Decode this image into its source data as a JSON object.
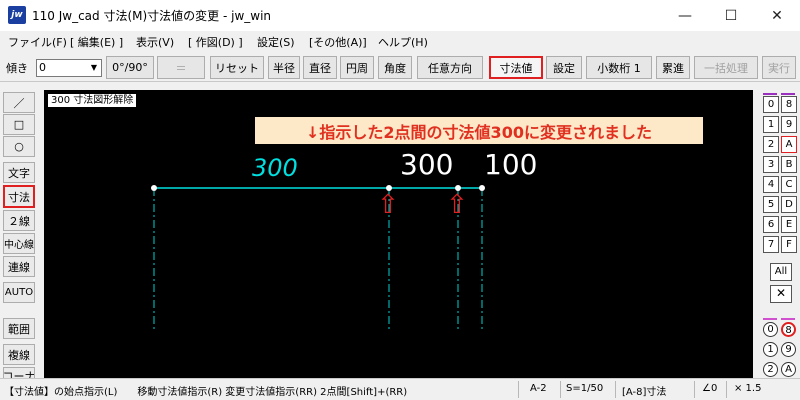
{
  "window": {
    "app_icon_text": "jw",
    "title": "110 Jw_cad 寸法(M)寸法値の変更 - jw_win",
    "minimize": "—",
    "maximize": "☐",
    "close": "✕"
  },
  "menu": [
    "ファイル(F)",
    "[ 編集(E) ]",
    "表示(V)",
    "[ 作図(D) ]",
    "設定(S)",
    "[その他(A)]",
    "ヘルプ(H)"
  ],
  "toolbar": {
    "angle_label": "傾き",
    "angle_value": "0",
    "angle_arrow": "▼",
    "buttons": {
      "deg": "0°/90°",
      "equal": "＝",
      "reset": "リセット",
      "radius": "半径",
      "diameter": "直径",
      "circumference": "円周",
      "angle": "角度",
      "arbitrary": "任意方向",
      "dim_value": "寸法値",
      "settings": "設定",
      "decimal": "小数桁 1",
      "cumulative": "累進",
      "batch": "一括処理",
      "execute": "実行"
    }
  },
  "left_panel": {
    "line_icon": "／",
    "rect_icon": "□",
    "circle_icon": "○",
    "text": "文字",
    "dimension": "寸法",
    "double_line": "２線",
    "center_line": "中心線",
    "continuous_line": "連線",
    "auto": "AUTO",
    "range": "範囲",
    "copy": "複線",
    "corner": "コーナ"
  },
  "canvas": {
    "command_label": "300  寸法図形解除",
    "banner": "↓指示した2点間の寸法値300に変更されました",
    "dim_cyan": "300",
    "dim_white_1": "300",
    "dim_white_2": "100",
    "marker_1": "⇧",
    "marker_2": "⇧"
  },
  "right_panel": {
    "layers_left": [
      "0",
      "1",
      "2",
      "3",
      "4",
      "5",
      "6",
      "7"
    ],
    "layers_right": [
      "8",
      "9",
      "A",
      "B",
      "C",
      "D",
      "E",
      "F"
    ],
    "all": "All",
    "x_icon": "✕",
    "groups_left": [
      "0",
      "1",
      "2"
    ],
    "groups_right": [
      "8",
      "9",
      "A"
    ]
  },
  "status": {
    "prompt": "【寸法値】の始点指示(L)　　移動寸法値指示(R)  変更寸法値指示(RR) 2点間[Shift]+(RR)",
    "layer": "A-2",
    "scale": "S=1/50",
    "layer_group": "[A-8]寸法",
    "angle": "∠0",
    "zoom": "× 1.5"
  }
}
